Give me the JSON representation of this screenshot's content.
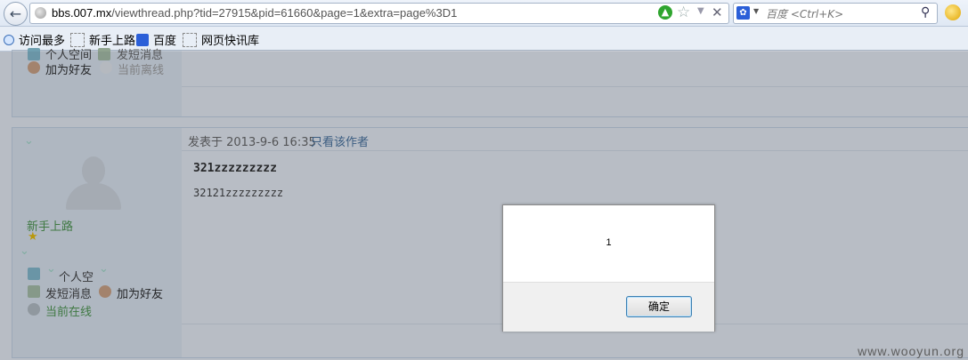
{
  "browser": {
    "url_host": "bbs.007.mx",
    "url_path": "/viewthread.php?tid=27915&pid=61660&page=1&extra=page%3D1",
    "search_placeholder": "百度 <Ctrl+K>",
    "bookmarks": [
      "访问最多",
      "新手上路",
      "百度",
      "网页快讯库"
    ]
  },
  "previous_post": {
    "row1_left": "个人空间",
    "row1_right": "发短消息",
    "add_friend": "加为好友",
    "status": "当前离线"
  },
  "post": {
    "posted_at": "发表于 2013-9-6 16:35",
    "only_author": "只看该作者",
    "title": "321zzzzzzzzz",
    "body": "32121zzzzzzzzz",
    "user_group": "新手上路",
    "space": "个人空",
    "send_pm": "发短消息",
    "add_friend": "加为好友",
    "status": "当前在线"
  },
  "dialog": {
    "message": "1",
    "ok_label": "确定"
  },
  "watermark": "www.wooyun.org",
  "colors": {
    "online_green": "#3f7f3f",
    "link_blue": "#3a5f86"
  },
  "icons": [
    "back-arrow-icon",
    "globe-icon",
    "go-arrow-icon",
    "star-icon",
    "stop-icon",
    "baidu-icon",
    "search-icon"
  ]
}
